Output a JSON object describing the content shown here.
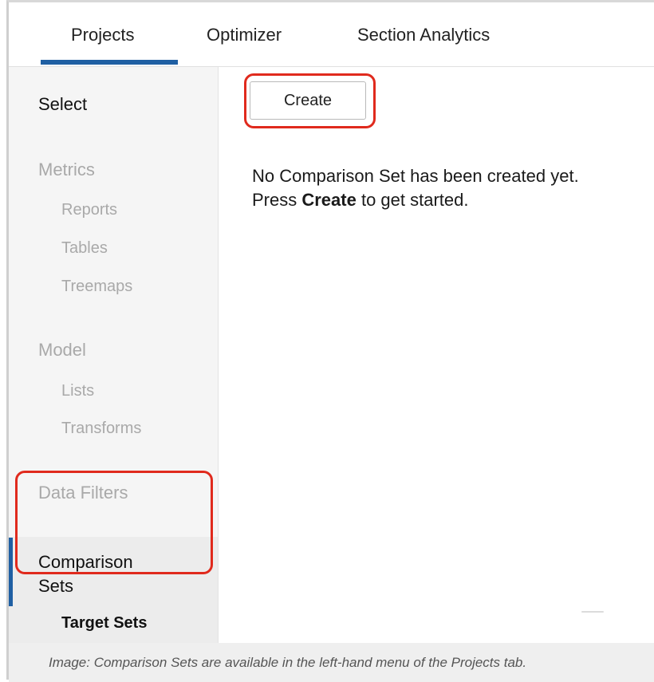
{
  "tabs": [
    {
      "label": "Projects",
      "active": true
    },
    {
      "label": "Optimizer",
      "active": false
    },
    {
      "label": "Section Analytics",
      "active": false
    }
  ],
  "sidebar": {
    "select": "Select",
    "groups": [
      {
        "label": "Metrics",
        "items": [
          "Reports",
          "Tables",
          "Treemaps"
        ]
      },
      {
        "label": "Model",
        "items": [
          "Lists",
          "Transforms"
        ]
      },
      {
        "label": "Data Filters",
        "items": []
      }
    ],
    "active_group": {
      "label_line1": "Comparison",
      "label_line2": "Sets",
      "item": "Target Sets"
    }
  },
  "main": {
    "create_label": "Create",
    "message_line1": "No Comparison Set has been created yet.",
    "message_line2_prefix": "Press ",
    "message_line2_bold": "Create",
    "message_line2_suffix": " to get started."
  },
  "caption": "Image: Comparison Sets are available in the left-hand menu of the Projects tab.",
  "colors": {
    "accent": "#1f5fa3",
    "highlight": "#e02a1d",
    "muted_text": "#a9a9a9"
  }
}
